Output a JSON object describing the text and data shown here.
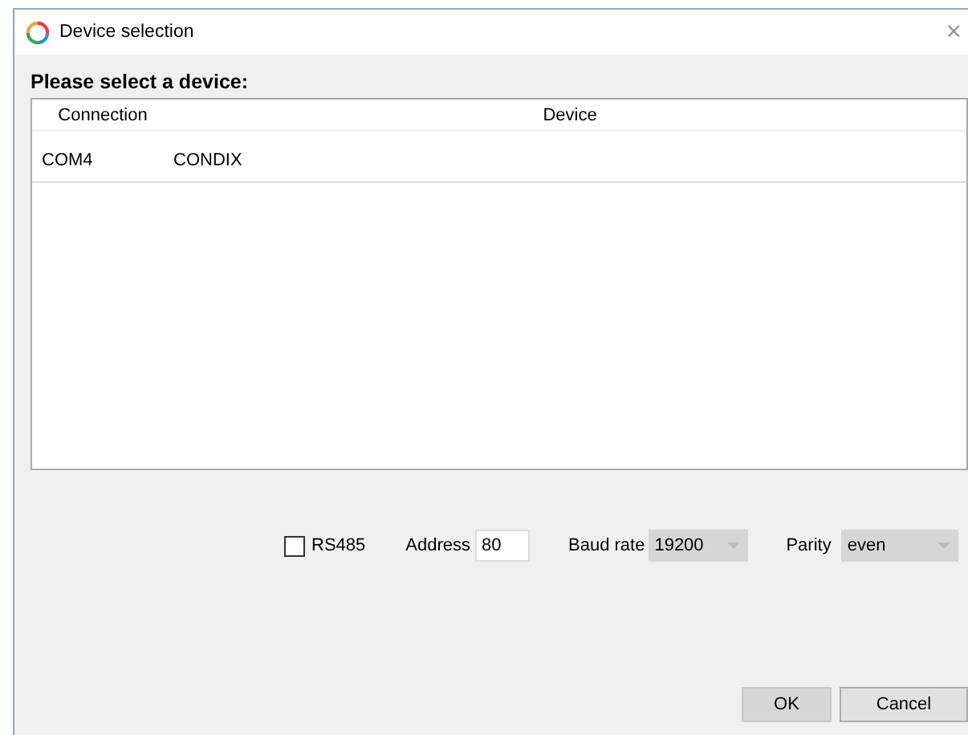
{
  "window": {
    "title": "Device selection",
    "close": "×"
  },
  "heading": "Please select a device:",
  "table": {
    "columns": [
      "Connection",
      "Device"
    ],
    "rows": [
      {
        "cells": [
          "COM4",
          "CONDIX"
        ],
        "selected": false
      }
    ]
  },
  "options": {
    "rs485": {
      "label": "RS485",
      "checked": false
    },
    "address": {
      "label": "Address",
      "value": "80",
      "disabled": false
    },
    "baud_rate": {
      "label": "Baud rate",
      "value": "19200",
      "disabled": true
    },
    "parity": {
      "label": "Parity",
      "value": "even",
      "disabled": true
    }
  },
  "buttons": [
    {
      "label": "OK",
      "kind": "default"
    },
    {
      "label": "Cancel",
      "kind": "normal"
    }
  ]
}
